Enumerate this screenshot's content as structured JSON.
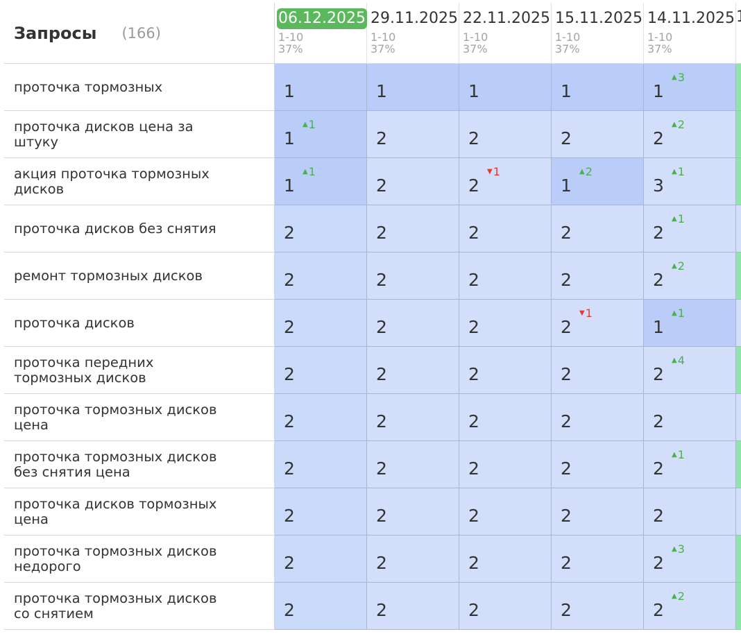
{
  "header": {
    "title": "Запросы",
    "count": "(166)",
    "range": "1-10",
    "edge_char": "1",
    "dates": [
      {
        "date": "06.12.2025",
        "active": true,
        "pct": "37%"
      },
      {
        "date": "29.11.2025",
        "active": false,
        "pct": "37%"
      },
      {
        "date": "22.11.2025",
        "active": false,
        "pct": "37%"
      },
      {
        "date": "15.11.2025",
        "active": false,
        "pct": "37%"
      },
      {
        "date": "14.11.2025",
        "active": false,
        "pct": "37%"
      }
    ]
  },
  "colors": {
    "active_date": "#5cb85c",
    "up": "#4caf50",
    "down": "#e53935",
    "top_cell": "#b9cdf8",
    "cell": "#d2defa",
    "edge_green": "#8ee6a8"
  },
  "rows": [
    {
      "query": "проточка тормозных",
      "edge": "green",
      "cells": [
        {
          "v": "1",
          "top": true
        },
        {
          "v": "1",
          "top": true
        },
        {
          "v": "1",
          "top": true
        },
        {
          "v": "1",
          "top": true
        },
        {
          "v": "1",
          "top": true,
          "d": "3",
          "dir": "up"
        }
      ]
    },
    {
      "query": "проточка дисков цена за штуку",
      "edge": "green",
      "cells": [
        {
          "v": "1",
          "top": true,
          "d": "1",
          "dir": "up"
        },
        {
          "v": "2"
        },
        {
          "v": "2"
        },
        {
          "v": "2"
        },
        {
          "v": "2",
          "d": "2",
          "dir": "up"
        }
      ]
    },
    {
      "query": "акция проточка тормозных дисков",
      "edge": "green",
      "cells": [
        {
          "v": "1",
          "top": true,
          "d": "1",
          "dir": "up"
        },
        {
          "v": "2"
        },
        {
          "v": "2",
          "d": "1",
          "dir": "down"
        },
        {
          "v": "1",
          "top": true,
          "d": "2",
          "dir": "up"
        },
        {
          "v": "3",
          "d": "1",
          "dir": "up"
        }
      ]
    },
    {
      "query": "проточка дисков без снятия",
      "edge": "blue",
      "cells": [
        {
          "v": "2"
        },
        {
          "v": "2"
        },
        {
          "v": "2"
        },
        {
          "v": "2"
        },
        {
          "v": "2",
          "d": "1",
          "dir": "up"
        }
      ]
    },
    {
      "query": "ремонт тормозных дисков",
      "edge": "green",
      "cells": [
        {
          "v": "2"
        },
        {
          "v": "2"
        },
        {
          "v": "2"
        },
        {
          "v": "2"
        },
        {
          "v": "2",
          "d": "2",
          "dir": "up"
        }
      ]
    },
    {
      "query": "проточка дисков",
      "edge": "blue",
      "cells": [
        {
          "v": "2"
        },
        {
          "v": "2"
        },
        {
          "v": "2"
        },
        {
          "v": "2",
          "d": "1",
          "dir": "down"
        },
        {
          "v": "1",
          "top": true,
          "d": "1",
          "dir": "up"
        }
      ]
    },
    {
      "query": "проточка передних тормозных дисков",
      "edge": "green",
      "cells": [
        {
          "v": "2"
        },
        {
          "v": "2"
        },
        {
          "v": "2"
        },
        {
          "v": "2"
        },
        {
          "v": "2",
          "d": "4",
          "dir": "up"
        }
      ]
    },
    {
      "query": "проточка тормозных дисков цена",
      "edge": "blue",
      "cells": [
        {
          "v": "2"
        },
        {
          "v": "2"
        },
        {
          "v": "2"
        },
        {
          "v": "2"
        },
        {
          "v": "2"
        }
      ]
    },
    {
      "query": "проточка тормозных дисков без снятия цена",
      "edge": "green",
      "cells": [
        {
          "v": "2"
        },
        {
          "v": "2"
        },
        {
          "v": "2"
        },
        {
          "v": "2"
        },
        {
          "v": "2",
          "d": "1",
          "dir": "up"
        }
      ]
    },
    {
      "query": "проточка дисков тормозных цена",
      "edge": "blue",
      "cells": [
        {
          "v": "2"
        },
        {
          "v": "2"
        },
        {
          "v": "2"
        },
        {
          "v": "2"
        },
        {
          "v": "2"
        }
      ]
    },
    {
      "query": "проточка тормозных дисков недорого",
      "edge": "green",
      "cells": [
        {
          "v": "2"
        },
        {
          "v": "2"
        },
        {
          "v": "2"
        },
        {
          "v": "2"
        },
        {
          "v": "2",
          "d": "3",
          "dir": "up"
        }
      ]
    },
    {
      "query": "проточка тормозных дисков со снятием",
      "edge": "green",
      "cells": [
        {
          "v": "2"
        },
        {
          "v": "2"
        },
        {
          "v": "2"
        },
        {
          "v": "2"
        },
        {
          "v": "2",
          "d": "2",
          "dir": "up"
        }
      ]
    }
  ]
}
